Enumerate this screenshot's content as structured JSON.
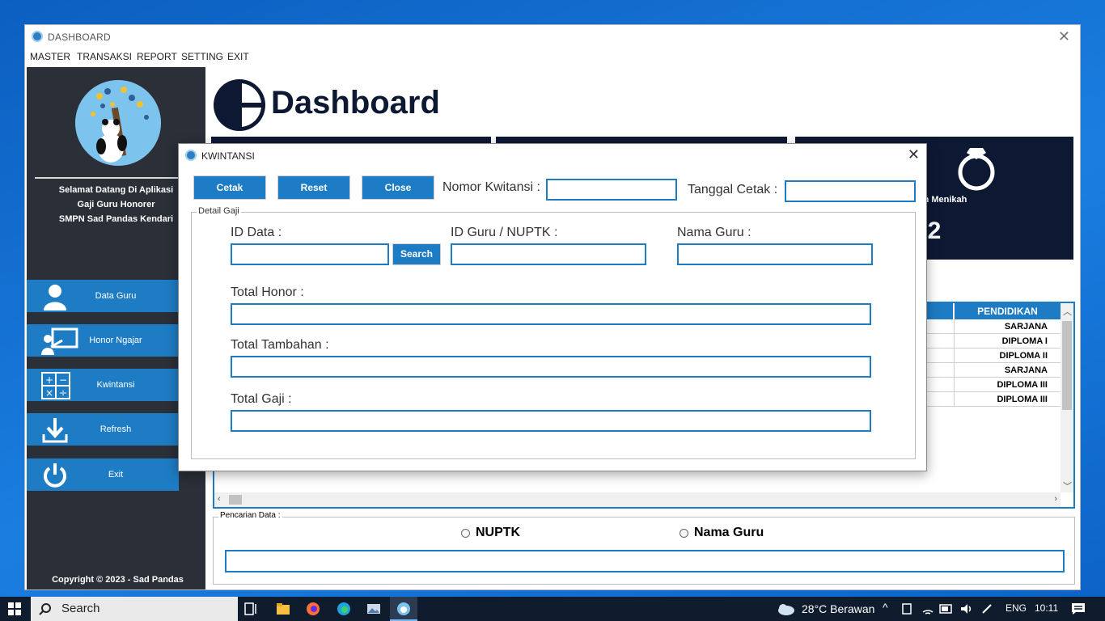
{
  "window": {
    "title": "DASHBOARD"
  },
  "menu": [
    "MASTER",
    "TRANSAKSI",
    "REPORT",
    "SETTING",
    "EXIT"
  ],
  "sidebar": {
    "welcome": [
      "Selamat Datang Di Aplikasi",
      "Gaji Guru Honorer",
      "SMPN Sad Pandas Kendari"
    ],
    "items": [
      {
        "label": "Data Guru",
        "icon": "user-icon"
      },
      {
        "label": "Honor Ngajar",
        "icon": "teacher-board-icon"
      },
      {
        "label": "Kwintansi",
        "icon": "calculator-icon"
      },
      {
        "label": "Refresh",
        "icon": "download-icon"
      },
      {
        "label": "Exit",
        "icon": "power-icon"
      }
    ],
    "copyright": "Copyright © 2023 - Sad Pandas"
  },
  "main": {
    "title": "Dashboard",
    "card": {
      "title": "Belum Menikah",
      "value": "2"
    },
    "table": {
      "header": "PENDIDIKAN",
      "rows": [
        "SARJANA",
        "DIPLOMA I",
        "DIPLOMA II",
        "SARJANA",
        "DIPLOMA III",
        "DIPLOMA III"
      ]
    },
    "search": {
      "legend": "Pencarian Data :",
      "option1": "NUPTK",
      "option2": "Nama Guru",
      "value": ""
    }
  },
  "dialog": {
    "title": "KWINTANSI",
    "buttons": {
      "print": "Cetak",
      "reset": "Reset",
      "close": "Close",
      "search": "Search"
    },
    "labels": {
      "receipt_no": "Nomor Kwitansi :",
      "print_date": "Tanggal Cetak :",
      "group": "Detail Gaji",
      "id_data": "ID Data :",
      "id_guru": "ID Guru / NUPTK :",
      "nama_guru": "Nama Guru :",
      "total_honor": "Total Honor :",
      "total_tambahan": "Total Tambahan :",
      "total_gaji": "Total Gaji :"
    },
    "values": {
      "receipt_no": "",
      "print_date": "",
      "id_data": "",
      "id_guru": "",
      "nama_guru": "",
      "total_honor": "",
      "total_tambahan": "",
      "total_gaji": ""
    }
  },
  "taskbar": {
    "search_placeholder": "Search",
    "weather": "28°C  Berawan",
    "language": "ENG",
    "time": "10:11"
  },
  "colors": {
    "accent": "#1e7cc4",
    "navy": "#0d1833",
    "sidebar": "#2a2f38"
  }
}
